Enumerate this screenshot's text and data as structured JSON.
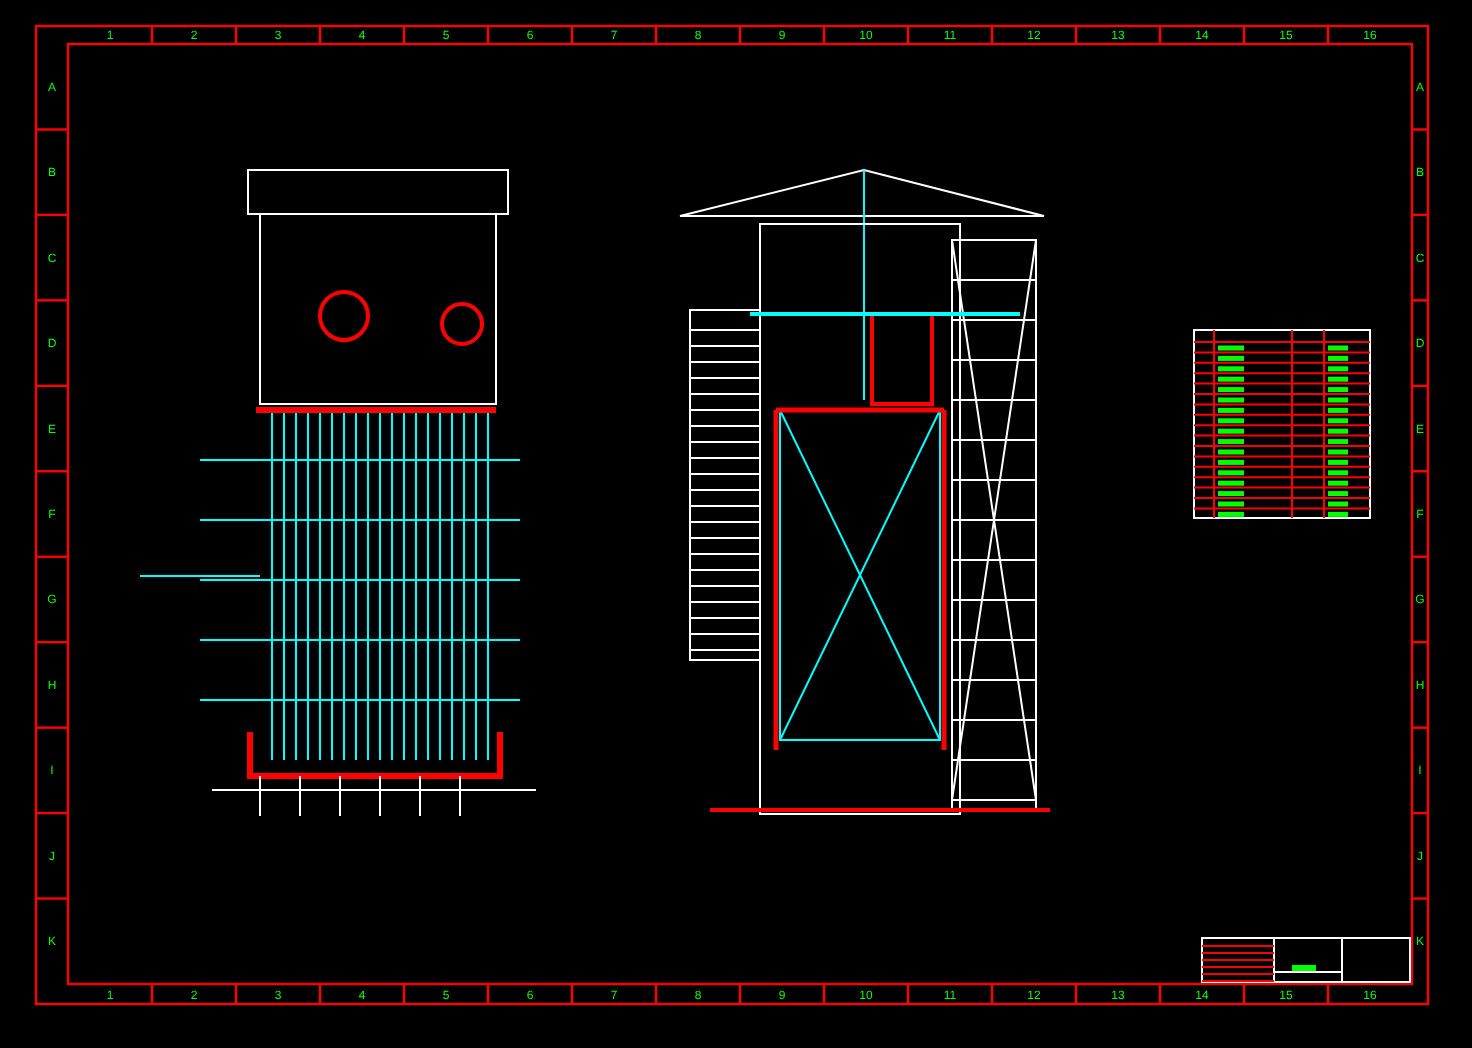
{
  "sheet": {
    "top_column_labels": [
      "1",
      "2",
      "3",
      "4",
      "5",
      "6",
      "7",
      "8",
      "9",
      "10",
      "11",
      "12",
      "13",
      "14",
      "15",
      "16"
    ],
    "bottom_column_labels": [
      "1",
      "2",
      "3",
      "4",
      "5",
      "6",
      "7",
      "8",
      "9",
      "10",
      "11",
      "12",
      "13",
      "14",
      "15",
      "16"
    ],
    "left_row_labels": [
      "A",
      "B",
      "C",
      "D",
      "E",
      "F",
      "G",
      "H",
      "I",
      "J",
      "K"
    ],
    "right_row_labels": [
      "A",
      "B",
      "C",
      "D",
      "E",
      "F",
      "G",
      "H",
      "I",
      "J",
      "K"
    ]
  }
}
